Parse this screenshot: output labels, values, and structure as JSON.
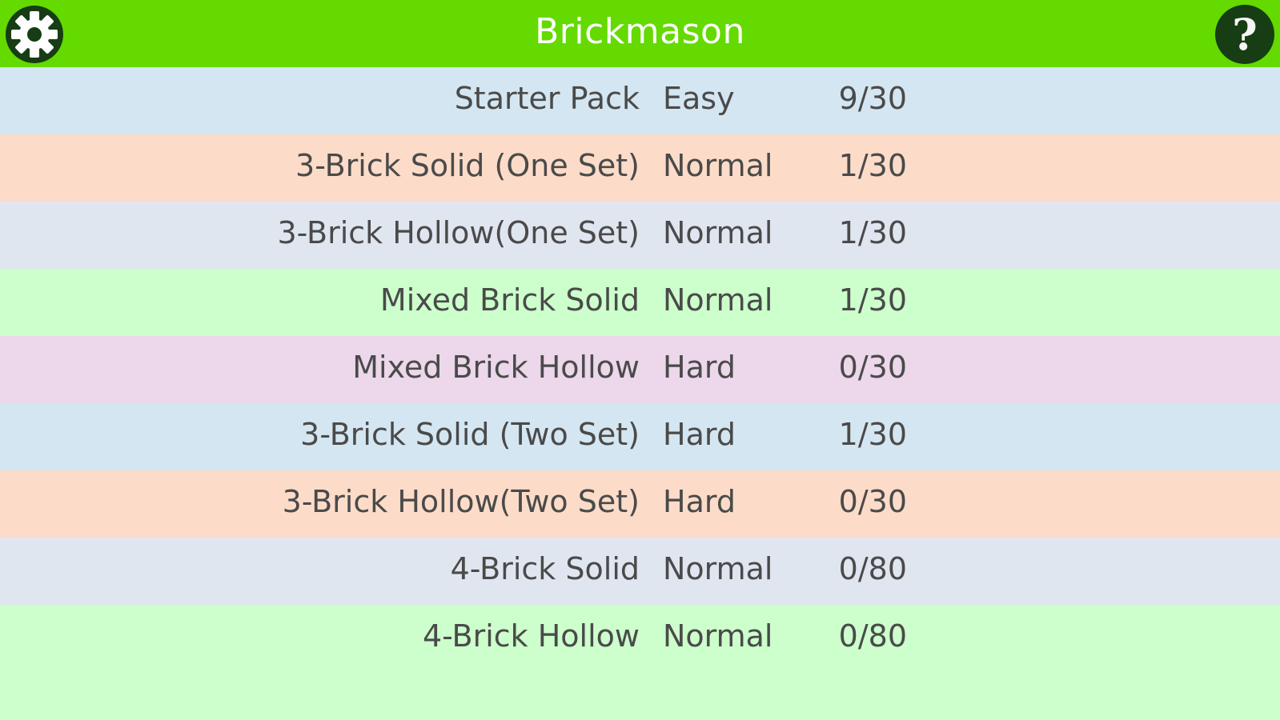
{
  "header": {
    "title": "Brickmason",
    "settings_icon": "gear-icon",
    "help_icon": "help-icon",
    "help_glyph": "?"
  },
  "colors": {
    "header_bg": "#64da00",
    "title_text": "#ffffff",
    "row_text": "#4a4a4a",
    "help_circle": "#173d14",
    "list_bg": "#ccffcc"
  },
  "packs": [
    {
      "name": "Starter Pack",
      "difficulty": "Easy",
      "progress": "9/30",
      "bg": "#d4e6f1"
    },
    {
      "name": "3-Brick Solid (One Set)",
      "difficulty": "Normal",
      "progress": "1/30",
      "bg": "#fcdcc8"
    },
    {
      "name": "3-Brick Hollow(One Set)",
      "difficulty": "Normal",
      "progress": "1/30",
      "bg": "#e0e6f0"
    },
    {
      "name": "Mixed Brick Solid",
      "difficulty": "Normal",
      "progress": "1/30",
      "bg": "#ccffcc"
    },
    {
      "name": "Mixed Brick Hollow",
      "difficulty": "Hard",
      "progress": "0/30",
      "bg": "#ecd8ea"
    },
    {
      "name": "3-Brick Solid (Two Set)",
      "difficulty": "Hard",
      "progress": "1/30",
      "bg": "#d4e6f1"
    },
    {
      "name": "3-Brick Hollow(Two Set)",
      "difficulty": "Hard",
      "progress": "0/30",
      "bg": "#fcdcc8"
    },
    {
      "name": "4-Brick Solid",
      "difficulty": "Normal",
      "progress": "0/80",
      "bg": "#e0e6f0"
    },
    {
      "name": "4-Brick Hollow",
      "difficulty": "Normal",
      "progress": "0/80",
      "bg": "#ccffcc"
    }
  ]
}
